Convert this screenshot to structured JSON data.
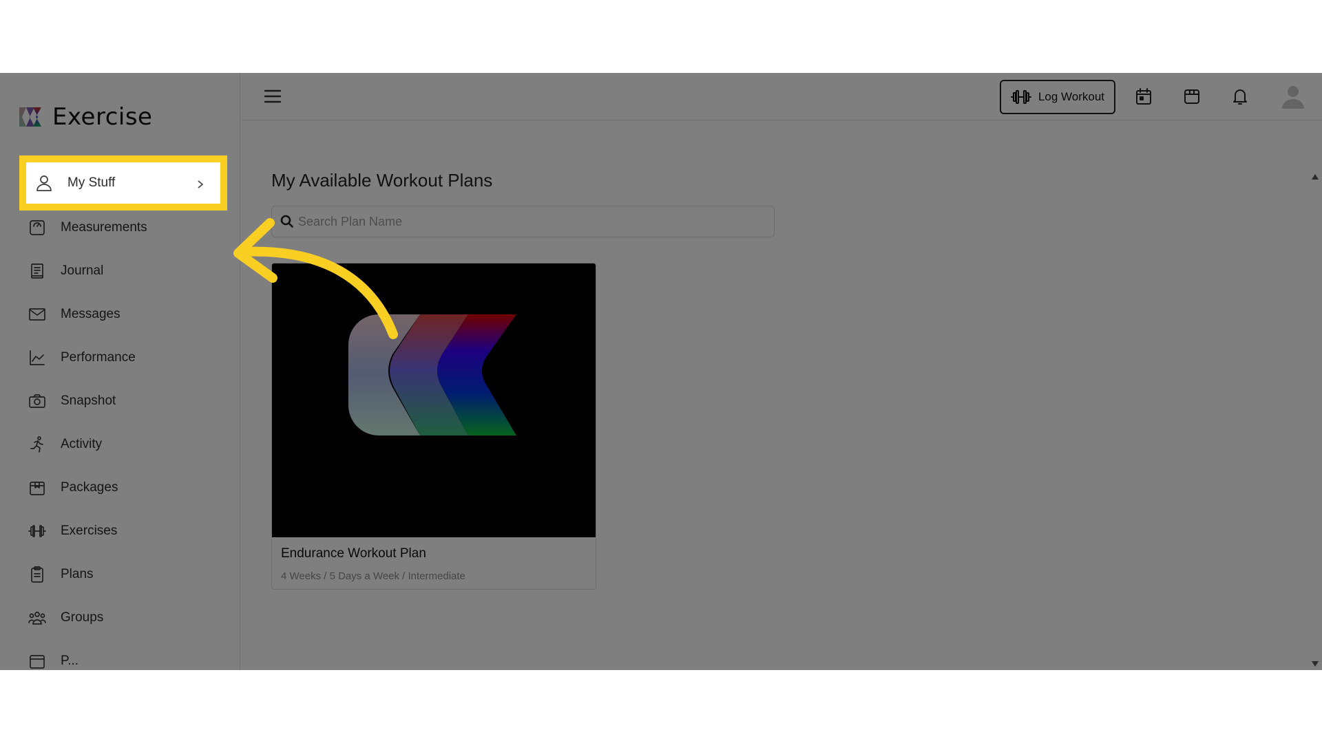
{
  "app": {
    "name": "Exercise"
  },
  "sidebar": {
    "items": [
      {
        "label": "My Stuff",
        "icon": "user-icon"
      },
      {
        "label": "Measurements",
        "icon": "scale-icon"
      },
      {
        "label": "Journal",
        "icon": "journal-icon"
      },
      {
        "label": "Messages",
        "icon": "mail-icon"
      },
      {
        "label": "Performance",
        "icon": "chart-icon"
      },
      {
        "label": "Snapshot",
        "icon": "camera-icon"
      },
      {
        "label": "Activity",
        "icon": "running-icon"
      },
      {
        "label": "Packages",
        "icon": "package-icon"
      },
      {
        "label": "Exercises",
        "icon": "dumbbell-icon"
      },
      {
        "label": "Plans",
        "icon": "clipboard-icon"
      },
      {
        "label": "Groups",
        "icon": "group-icon"
      },
      {
        "label": "P...",
        "icon": "truncated-icon"
      }
    ]
  },
  "topbar": {
    "log_workout_label": "Log Workout",
    "icons": [
      "menu-icon",
      "dumbbell-icon",
      "calendar-icon",
      "box-icon",
      "bell-icon",
      "avatar"
    ]
  },
  "main": {
    "title": "My Available Workout Plans",
    "search": {
      "placeholder": "Search Plan Name",
      "value": ""
    },
    "plans": [
      {
        "title": "Endurance Workout Plan",
        "meta": "4 Weeks / 5 Days a Week / Intermediate"
      }
    ]
  },
  "overlay": {
    "highlight_color": "#f9cf24",
    "dim_color": "rgba(0,0,0,0.5)"
  }
}
